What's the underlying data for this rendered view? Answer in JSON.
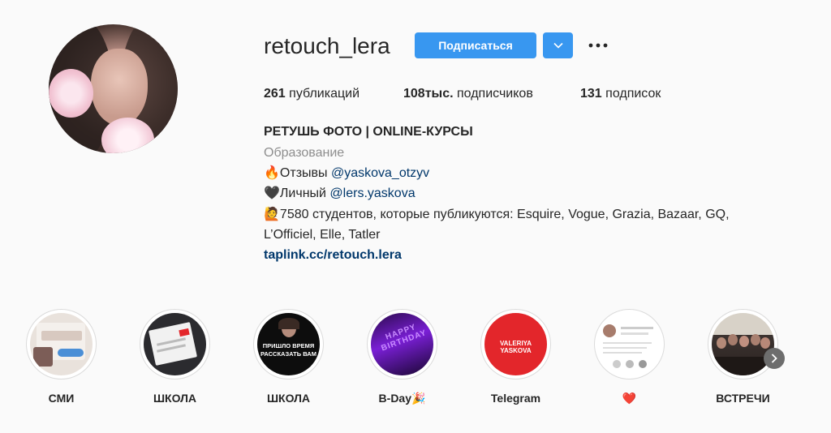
{
  "profile": {
    "username": "retouch_lera",
    "follow_label": "Подписаться",
    "stats": {
      "posts_count": "261",
      "posts_label": "публикаций",
      "followers_count": "108тыс.",
      "followers_label": "подписчиков",
      "following_count": "131",
      "following_label": "подписок"
    },
    "bio": {
      "name": "РЕТУШЬ ФОТО | ONLINE-КУРСЫ",
      "category": "Образование",
      "line1_emoji": "🔥",
      "line1_text": "Отзывы ",
      "line1_mention": "@yaskova_otzyv",
      "line2_emoji": "🖤",
      "line2_text": "Личный ",
      "line2_mention": "@lers.yaskova",
      "line3_emoji": "🙋",
      "line3_text": "7580 студентов, которые публикуются: Esquire, Vogue, Grazia, Bazaar, GQ,",
      "line4_text": "L’Officiel, Elle, Tatler",
      "website": "taplink.cc/retouch.lera"
    }
  },
  "highlights": [
    {
      "label": "СМИ",
      "thumb_text": "ИНТЕРВЬЮ ТУТ\n@ YOUTU.BE"
    },
    {
      "label": "ШКОЛА",
      "thumb_text": ""
    },
    {
      "label": "ШКОЛА",
      "thumb_text": "ПРИШЛО ВРЕМЯ\nРАССКАЗАТЬ ВАМ"
    },
    {
      "label": "B-Day🎉",
      "thumb_text": "HAPPY BIRTHDAY"
    },
    {
      "label": "Telegram",
      "thumb_text": "VALERIYA YASKOVA"
    },
    {
      "label": "❤️",
      "thumb_text": ""
    },
    {
      "label": "ВСТРЕЧИ",
      "thumb_text": ""
    }
  ],
  "icons": {
    "dropdown": "chevron-down-icon",
    "more": "more-horizontal-icon",
    "next": "chevron-right-icon"
  },
  "colors": {
    "accent": "#3897f0",
    "link": "#00376b",
    "muted": "#8e8e8e",
    "telegram_red": "#e3262b"
  }
}
